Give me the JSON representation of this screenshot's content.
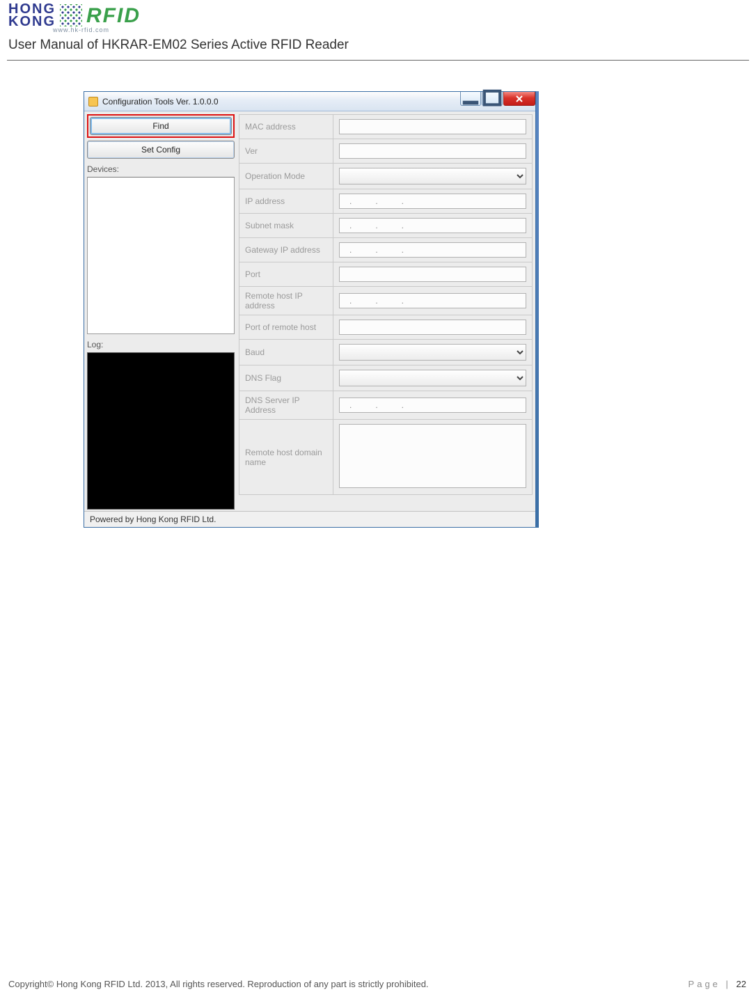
{
  "header": {
    "logo_hk1": "HONG",
    "logo_hk2": "KONG",
    "logo_rfid": "RFID",
    "logo_sub": "www.hk-rfid.com",
    "doc_title": "User Manual of HKRAR-EM02 Series Active RFID Reader"
  },
  "window": {
    "title": "Configuration Tools Ver. 1.0.0.0",
    "find_label": "Find",
    "set_config_label": "Set Config",
    "devices_label": "Devices:",
    "log_label": "Log:",
    "statusbar": "Powered by Hong Kong RFID Ltd.",
    "fields": {
      "mac": {
        "label": "MAC address",
        "value": ""
      },
      "ver": {
        "label": "Ver",
        "value": ""
      },
      "op_mode": {
        "label": "Operation Mode",
        "value": ""
      },
      "ip": {
        "label": "IP address",
        "value": ".   .   ."
      },
      "subnet": {
        "label": "Subnet mask",
        "value": ".   .   ."
      },
      "gateway": {
        "label": "Gateway IP address",
        "value": ".   .   ."
      },
      "port": {
        "label": "Port",
        "value": ""
      },
      "remote_ip": {
        "label": "Remote host IP address",
        "value": ".   .   ."
      },
      "remote_port": {
        "label": "Port of remote host",
        "value": ""
      },
      "baud": {
        "label": "Baud",
        "value": ""
      },
      "dns_flag": {
        "label": "DNS Flag",
        "value": ""
      },
      "dns_server": {
        "label": "DNS Server IP Address",
        "value": ".   .   ."
      },
      "remote_domain": {
        "label": "Remote host domain name",
        "value": ""
      }
    }
  },
  "footer": {
    "copyright": "Copyright© Hong Kong RFID Ltd. 2013, All rights reserved. Reproduction of any part is strictly prohibited.",
    "page_word": "Page",
    "page_sep": " | ",
    "page_num": "22"
  }
}
